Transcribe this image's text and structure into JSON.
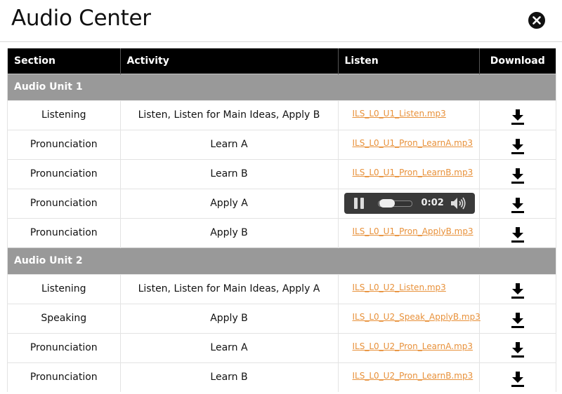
{
  "header": {
    "title": "Audio Center"
  },
  "table": {
    "columns": [
      "Section",
      "Activity",
      "Listen",
      "Download"
    ],
    "groups": [
      {
        "title": "Audio Unit 1",
        "rows": [
          {
            "section": "Listening",
            "activity": "Listen, Listen for Main Ideas, Apply B",
            "file": "ILS_L0_U1_Listen.mp3"
          },
          {
            "section": "Pronunciation",
            "activity": "Learn A",
            "file": "ILS_L0_U1_Pron_LearnA.mp3"
          },
          {
            "section": "Pronunciation",
            "activity": "Learn B",
            "file": "ILS_L0_U1_Pron_LearnB.mp3"
          },
          {
            "section": "Pronunciation",
            "activity": "Apply A",
            "file": "",
            "player": {
              "time": "0:02",
              "state": "playing",
              "progress": 0.1
            }
          },
          {
            "section": "Pronunciation",
            "activity": "Apply B",
            "file": "ILS_L0_U1_Pron_ApplyB.mp3"
          }
        ]
      },
      {
        "title": "Audio Unit 2",
        "rows": [
          {
            "section": "Listening",
            "activity": "Listen, Listen for Main Ideas, Apply A",
            "file": "ILS_L0_U2_Listen.mp3"
          },
          {
            "section": "Speaking",
            "activity": "Apply B",
            "file": "ILS_L0_U2_Speak_ApplyB.mp3"
          },
          {
            "section": "Pronunciation",
            "activity": "Learn A",
            "file": "ILS_L0_U2_Pron_LearnA.mp3"
          },
          {
            "section": "Pronunciation",
            "activity": "Learn B",
            "file": "ILS_L0_U2_Pron_LearnB.mp3"
          }
        ]
      }
    ]
  },
  "icons": {
    "close": "close-icon",
    "download": "download-icon",
    "pause": "pause-icon",
    "volume": "volume-icon"
  },
  "colors": {
    "link": "#e8913a",
    "header_bg": "#000000",
    "group_bg": "#999999",
    "player_bg": "#3a3a3a"
  }
}
